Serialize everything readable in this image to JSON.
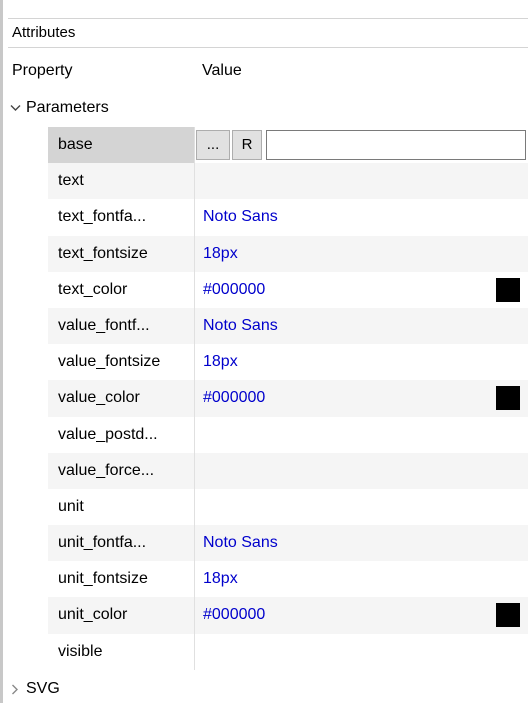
{
  "panel": {
    "title": "Attributes"
  },
  "header": {
    "property": "Property",
    "value": "Value"
  },
  "groups": {
    "parameters": {
      "label": "Parameters",
      "expanded": true
    },
    "svg": {
      "label": "SVG",
      "expanded": false
    }
  },
  "editor": {
    "dots_label": "...",
    "reset_label": "R",
    "input_value": ""
  },
  "rows": [
    {
      "name": "base",
      "value": "",
      "swatch": ""
    },
    {
      "name": "text",
      "value": "",
      "swatch": ""
    },
    {
      "name": "text_fontfa...",
      "value": "Noto Sans",
      "swatch": ""
    },
    {
      "name": "text_fontsize",
      "value": "18px",
      "swatch": ""
    },
    {
      "name": "text_color",
      "value": "#000000",
      "swatch": "#000000"
    },
    {
      "name": "value_fontf...",
      "value": "Noto Sans",
      "swatch": ""
    },
    {
      "name": "value_fontsize",
      "value": "18px",
      "swatch": ""
    },
    {
      "name": "value_color",
      "value": "#000000",
      "swatch": "#000000"
    },
    {
      "name": "value_postd...",
      "value": "",
      "swatch": ""
    },
    {
      "name": "value_force...",
      "value": "",
      "swatch": ""
    },
    {
      "name": "unit",
      "value": "",
      "swatch": ""
    },
    {
      "name": "unit_fontfa...",
      "value": "Noto Sans",
      "swatch": ""
    },
    {
      "name": "unit_fontsize",
      "value": "18px",
      "swatch": ""
    },
    {
      "name": "unit_color",
      "value": "#000000",
      "swatch": "#000000"
    },
    {
      "name": "visible",
      "value": "",
      "swatch": ""
    }
  ],
  "colors": {
    "value_text": "#0000cc",
    "selected_bg": "#d4d4d4",
    "alt_bg": "#f5f5f5"
  }
}
